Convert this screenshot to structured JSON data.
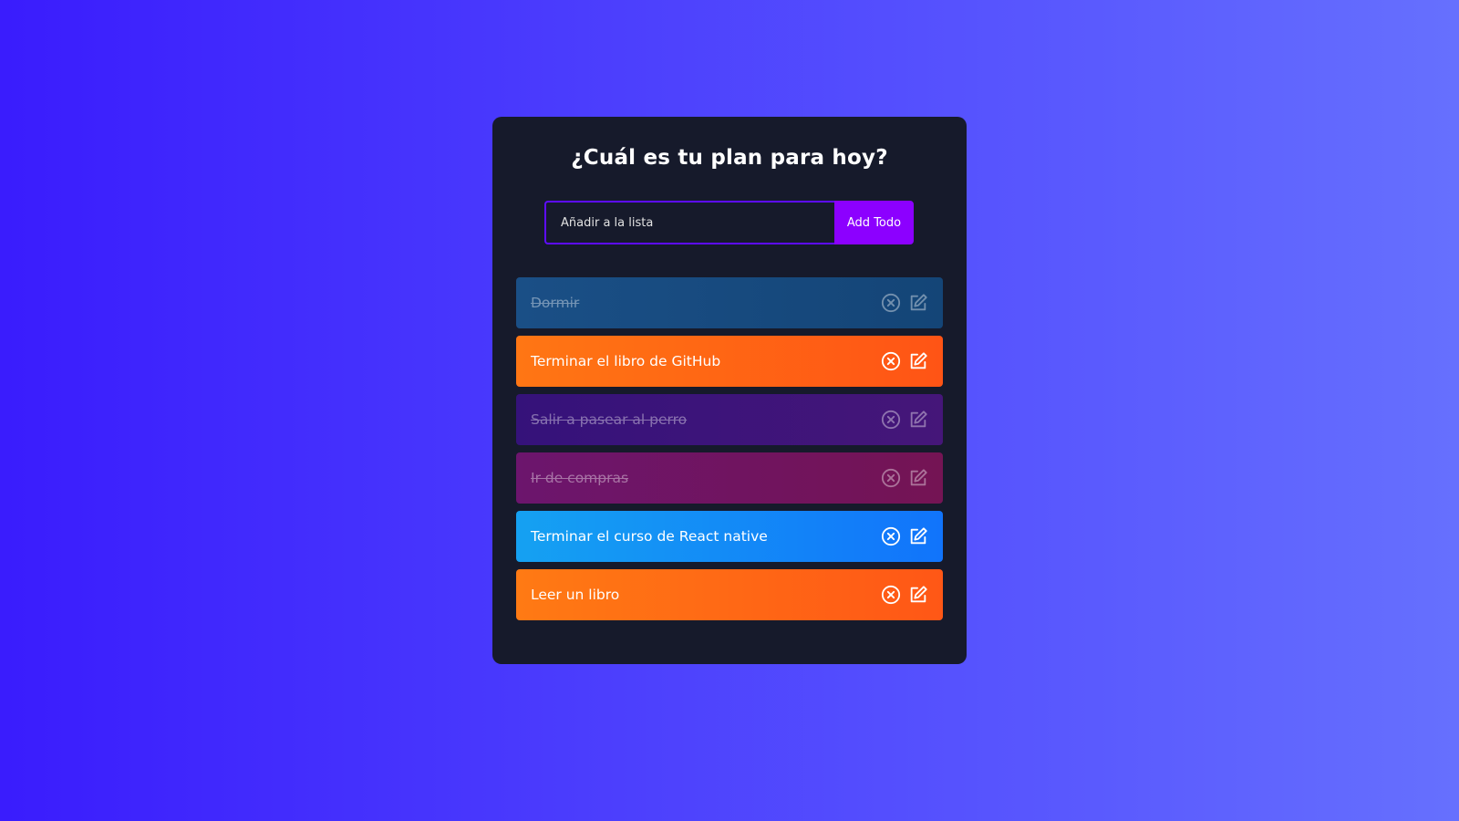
{
  "app": {
    "title": "¿Cuál es tu plan para hoy?"
  },
  "form": {
    "input_value": "",
    "input_placeholder": "Añadir a la lista",
    "button_label": "Add Todo"
  },
  "colors": {
    "app_background": "#161a2b",
    "input_border": "#5d0cff",
    "button_background": "#8c00ff"
  },
  "icons": {
    "remove": "close-circle-icon",
    "edit": "edit-icon"
  },
  "todos": [
    {
      "text": "Dormir",
      "completed": true,
      "gradient": [
        "#1a4f86",
        "#144577"
      ]
    },
    {
      "text": "Terminar el libro de GitHub",
      "completed": false,
      "gradient": [
        "#ff7614",
        "#ff5415"
      ]
    },
    {
      "text": "Salir a pasear al perro",
      "completed": true,
      "gradient": [
        "#35127a",
        "#451679"
      ]
    },
    {
      "text": "Ir de compras",
      "completed": true,
      "gradient": [
        "#6c156d",
        "#741454"
      ]
    },
    {
      "text": "Terminar el curso de React native",
      "completed": false,
      "gradient": [
        "#15a1f2",
        "#1174fb"
      ]
    },
    {
      "text": "Leer un libro",
      "completed": false,
      "gradient": [
        "#ff7a14",
        "#ff5716"
      ]
    }
  ]
}
